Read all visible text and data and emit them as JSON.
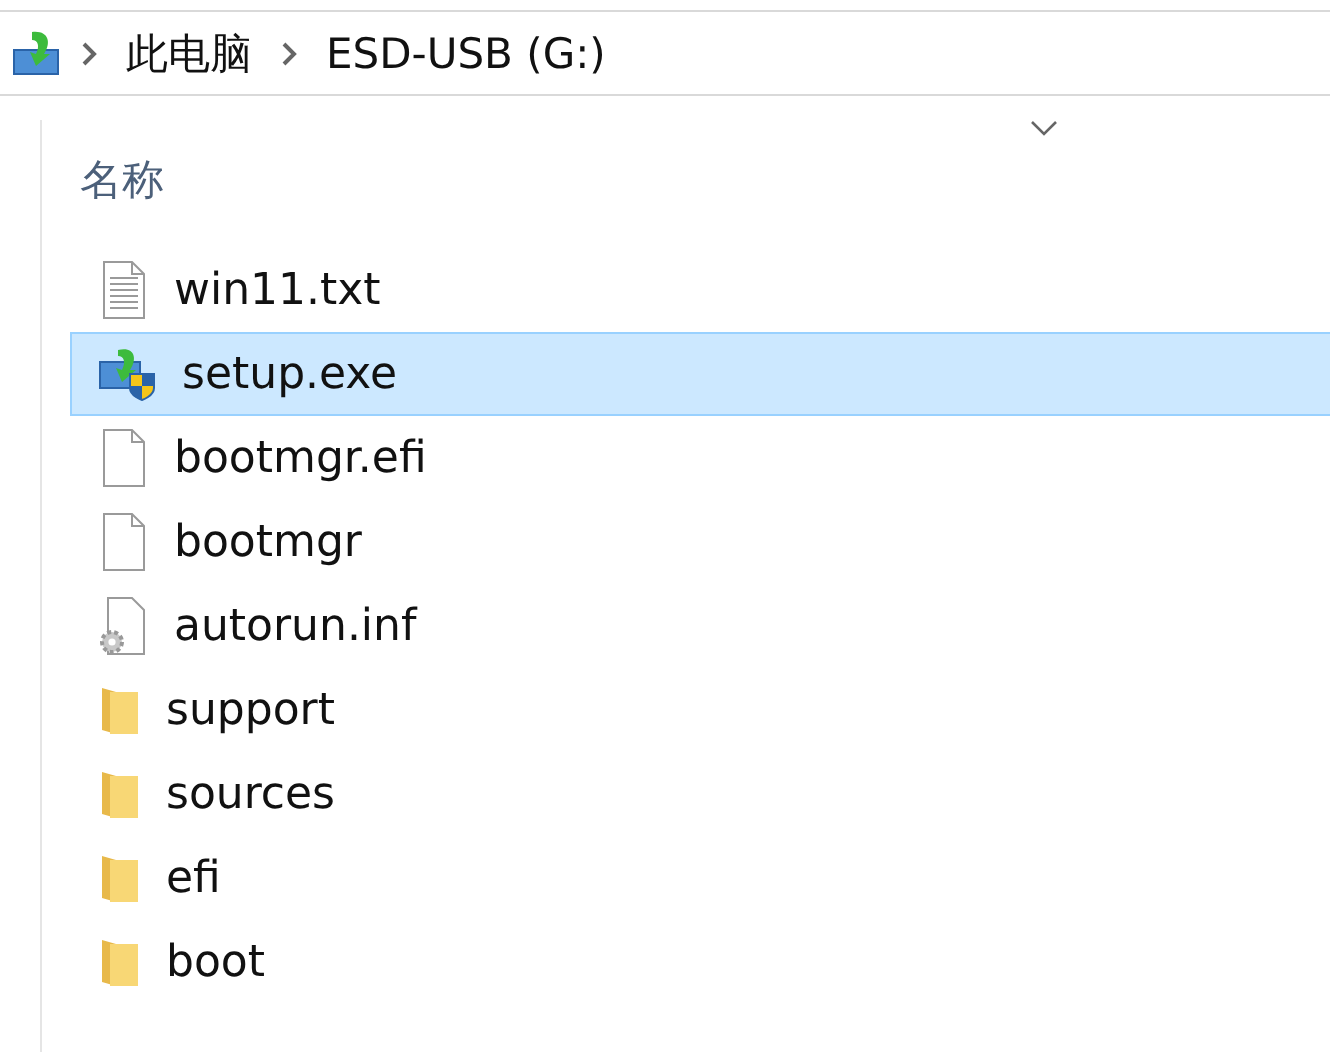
{
  "address_bar": {
    "breadcrumbs": [
      {
        "label": "此电脑"
      },
      {
        "label": "ESD-USB (G:)"
      }
    ]
  },
  "column_header": {
    "label": "名称",
    "sorted_descending": true
  },
  "files": [
    {
      "name": "win11.txt",
      "kind": "text",
      "selected": false
    },
    {
      "name": "setup.exe",
      "kind": "setup",
      "selected": true
    },
    {
      "name": "bootmgr.efi",
      "kind": "file",
      "selected": false
    },
    {
      "name": "bootmgr",
      "kind": "file",
      "selected": false
    },
    {
      "name": "autorun.inf",
      "kind": "config",
      "selected": false
    },
    {
      "name": "support",
      "kind": "folder",
      "selected": false
    },
    {
      "name": "sources",
      "kind": "folder",
      "selected": false
    },
    {
      "name": "efi",
      "kind": "folder",
      "selected": false
    },
    {
      "name": "boot",
      "kind": "folder",
      "selected": false
    }
  ]
}
